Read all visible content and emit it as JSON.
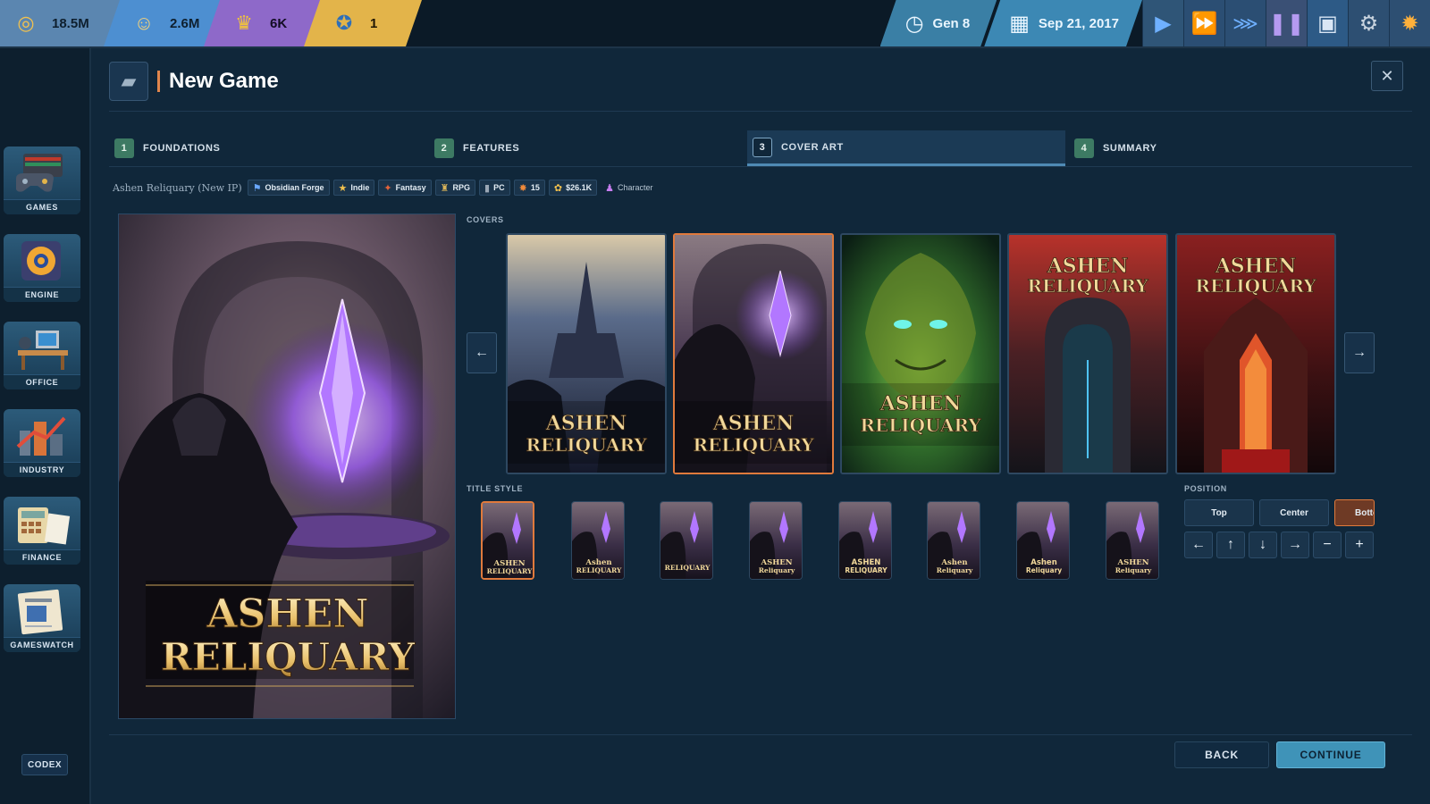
{
  "topbar": {
    "money": {
      "value": "18.5M",
      "icon": "coins-icon"
    },
    "fans": {
      "value": "2.6M",
      "icon": "fans-icon"
    },
    "crown": {
      "value": "6K",
      "icon": "crown-icon"
    },
    "award": {
      "value": "1",
      "icon": "award-icon"
    },
    "generation": "Gen 8",
    "date": "Sep 21, 2017"
  },
  "sidebar": {
    "items": [
      {
        "label": "GAMES",
        "icon": "games-icon"
      },
      {
        "label": "ENGINE",
        "icon": "engine-icon"
      },
      {
        "label": "OFFICE",
        "icon": "office-icon"
      },
      {
        "label": "INDUSTRY",
        "icon": "industry-icon"
      },
      {
        "label": "FINANCE",
        "icon": "finance-icon"
      },
      {
        "label": "GAMESWATCH",
        "icon": "gameswatch-icon"
      }
    ],
    "codex": "CODEX"
  },
  "header": {
    "title": "New Game",
    "close": "✕"
  },
  "steps": [
    {
      "num": "1",
      "label": "FOUNDATIONS",
      "active": false
    },
    {
      "num": "2",
      "label": "FEATURES",
      "active": false
    },
    {
      "num": "3",
      "label": "COVER ART",
      "active": true
    },
    {
      "num": "4",
      "label": "SUMMARY",
      "active": false
    }
  ],
  "summary": {
    "game_name": "Ashen Reliquary (New IP)",
    "studio": "Obsidian Forge",
    "size": "Indie",
    "genre": "Fantasy",
    "type": "RPG",
    "platform": "PC",
    "features": "15",
    "cost": "$26.1K",
    "focus": "Character"
  },
  "preview": {
    "title_line1": "ASHEN",
    "title_line2": "RELIQUARY"
  },
  "covers": {
    "label": "COVERS",
    "selected_index": 1,
    "items": [
      {
        "line1": "ASHEN",
        "line2": "RELIQUARY",
        "theme": "night-castle"
      },
      {
        "line1": "ASHEN",
        "line2": "RELIQUARY",
        "theme": "knight-crystal"
      },
      {
        "line1": "ASHEN",
        "line2": "RELIQUARY",
        "theme": "forest-spirit"
      },
      {
        "line1": "ASHEN",
        "line2": "RELIQUARY",
        "theme": "dark-gate"
      },
      {
        "line1": "ASHEN",
        "line2": "RELIQUARY",
        "theme": "red-temple"
      }
    ]
  },
  "title_style": {
    "label": "TITLE STYLE",
    "selected_index": 0,
    "items": [
      {
        "text": "ASHEN RELIQUARY"
      },
      {
        "text": "Ashen RELIQUARY"
      },
      {
        "text": "RELIQUARY"
      },
      {
        "text": "ASHEN Reliquary"
      },
      {
        "text": "ASHEN RELIQUARY"
      },
      {
        "text": "Ashen Reliquary"
      },
      {
        "text": "Ashen Reliquary"
      },
      {
        "text": "ASHEN Reliquary"
      }
    ]
  },
  "position": {
    "label": "POSITION",
    "options": [
      "Top",
      "Center",
      "Botto"
    ],
    "active": "Botto"
  },
  "footer": {
    "back": "BACK",
    "continue": "CONTINUE"
  },
  "colors": {
    "accent": "#e07a3c",
    "continue": "#3f93b8",
    "panel": "#10273a"
  }
}
